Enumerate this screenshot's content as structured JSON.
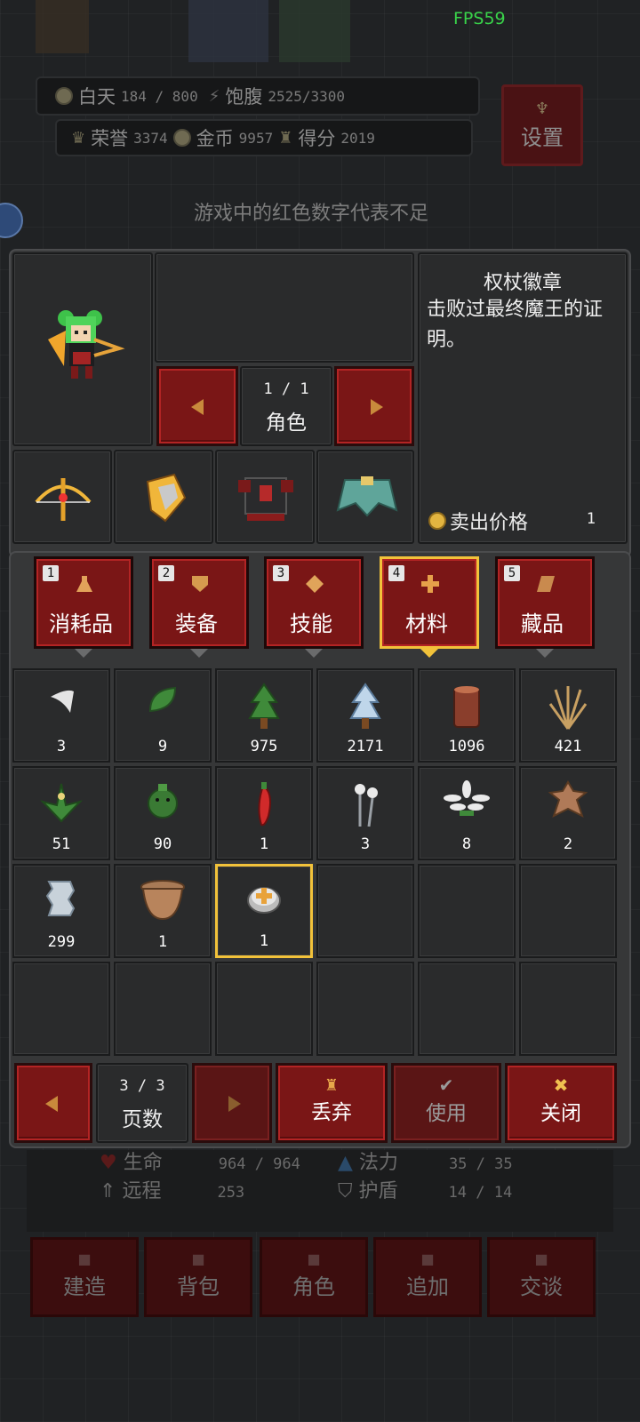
{
  "fps": "FPS59",
  "hud": {
    "day_label": "白天",
    "day_value": "184 / 800",
    "satiety_label": "饱腹",
    "satiety_value": "2525/3300",
    "honor_label": "荣誉",
    "honor_value": "3374",
    "gold_label": "金币",
    "gold_value": "9957",
    "score_label": "得分",
    "score_value": "2019",
    "settings_label": "设置",
    "tip": "游戏中的红色数字代表不足"
  },
  "character": {
    "pager": "1 / 1",
    "pager_label": "角色",
    "equipment": [
      "crossbow-icon",
      "gauntlet-icon",
      "armor-icon",
      "cape-icon"
    ]
  },
  "detail": {
    "title": "权杖徽章",
    "description": "击败过最终魔王的证明。",
    "sell_label": "卖出价格",
    "sell_value": "1"
  },
  "tabs": [
    {
      "num": "1",
      "label": "消耗品",
      "icon": "potion-icon",
      "active": false
    },
    {
      "num": "2",
      "label": "装备",
      "icon": "shield-icon",
      "active": false
    },
    {
      "num": "3",
      "label": "技能",
      "icon": "diamond-icon",
      "active": false
    },
    {
      "num": "4",
      "label": "材料",
      "icon": "cross-icon",
      "active": true
    },
    {
      "num": "5",
      "label": "藏品",
      "icon": "scroll-icon",
      "active": false
    }
  ],
  "inventory": [
    {
      "icon": "fang-icon",
      "qty": "3"
    },
    {
      "icon": "leaf-icon",
      "qty": "9"
    },
    {
      "icon": "pine-tree-icon",
      "qty": "975"
    },
    {
      "icon": "snow-pine-icon",
      "qty": "2171"
    },
    {
      "icon": "log-icon",
      "qty": "1096"
    },
    {
      "icon": "wheat-icon",
      "qty": "421"
    },
    {
      "icon": "herb-icon",
      "qty": "51"
    },
    {
      "icon": "cactus-icon",
      "qty": "90"
    },
    {
      "icon": "chili-icon",
      "qty": "1"
    },
    {
      "icon": "cotton-icon",
      "qty": "3"
    },
    {
      "icon": "flower-icon",
      "qty": "8"
    },
    {
      "icon": "hide-icon",
      "qty": "2"
    },
    {
      "icon": "cloth-icon",
      "qty": "299"
    },
    {
      "icon": "pot-icon",
      "qty": "1"
    },
    {
      "icon": "badge-icon",
      "qty": "1",
      "selected": true
    }
  ],
  "footer": {
    "page": "3 / 3",
    "page_label": "页数",
    "discard_label": "丢弃",
    "use_label": "使用",
    "close_label": "关闭"
  },
  "stats": {
    "hp_label": "生命",
    "hp_value": "964 / 964",
    "mp_label": "法力",
    "mp_value": "35 / 35",
    "range_label": "远程",
    "range_value": "253",
    "shield_label": "护盾",
    "shield_value": "14 / 14"
  },
  "nav": [
    "建造",
    "背包",
    "角色",
    "追加",
    "交谈"
  ],
  "colors": {
    "accent": "#f2c23a",
    "button_red": "#7a1616",
    "fps_green": "#39d34a"
  }
}
